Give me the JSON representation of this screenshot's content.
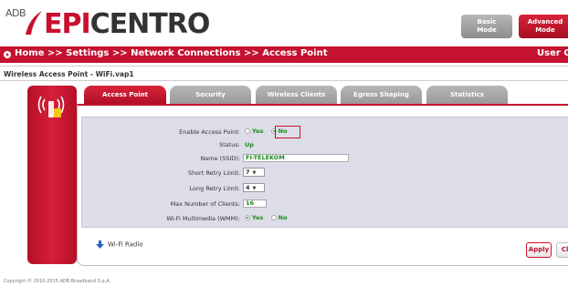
{
  "header": {
    "logo_prefix": "ADB",
    "logo_brand_red": "EPI",
    "logo_brand_dark": "CENTRO",
    "basic_mode": {
      "line1": "Basic",
      "line2": "Mode"
    },
    "advanced_mode": {
      "line1": "Advanced",
      "line2": "Mode"
    }
  },
  "breadcrumb": {
    "text": "Home >> Settings >> Network Connections >> Access Point",
    "user_guide": "User Gu"
  },
  "subtitle": "Wireless Access Point - WiFi.vap1",
  "tabs": [
    {
      "label": "Access Point",
      "active": true
    },
    {
      "label": "Security",
      "active": false
    },
    {
      "label": "Wireless Clients",
      "active": false
    },
    {
      "label": "Egress Shaping",
      "active": false
    },
    {
      "label": "Statistics",
      "active": false
    }
  ],
  "form": {
    "enable_ap": {
      "label": "Enable Access Point:",
      "yes": "Yes",
      "no": "No",
      "selected": "No"
    },
    "status": {
      "label": "Status:",
      "value": "Up"
    },
    "ssid": {
      "label": "Name (SSID):",
      "value": "FI-TELEKOM"
    },
    "short_retry": {
      "label": "Short Retry Limit:",
      "value": "7"
    },
    "long_retry": {
      "label": "Long Retry Limit:",
      "value": "4"
    },
    "max_clients": {
      "label": "Max Number of Clients:",
      "value": "16"
    },
    "wmm": {
      "label": "Wi-Fi Multimedia (WMM):",
      "yes": "Yes",
      "no": "No",
      "selected": "Yes"
    }
  },
  "wifi_radio_link": "Wi-Fi Radio",
  "buttons": {
    "apply": "Apply",
    "close": "Clo"
  },
  "copyright": "Copyright © 2010-2015 ADB Broadband S.p.A.",
  "colors": {
    "brand_red": "#c41230",
    "value_green": "#208820",
    "form_bg": "#dcdde8"
  }
}
